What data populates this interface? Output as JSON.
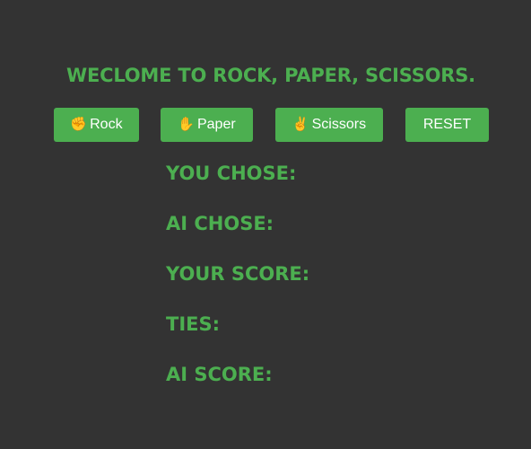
{
  "title": "WECLOME TO ROCK, PAPER, SCISSORS.",
  "buttons": {
    "rock": {
      "icon": "✊",
      "label": "Rock",
      "icon_name": "fist-icon"
    },
    "paper": {
      "icon": "✋",
      "label": "Paper",
      "icon_name": "hand-icon"
    },
    "scissors": {
      "icon": "✌",
      "label": "Scissors",
      "icon_name": "scissors-hand-icon"
    },
    "reset": {
      "label": "RESET"
    }
  },
  "stats": {
    "you_chose": "YOU CHOSE:",
    "ai_chose": "AI CHOSE:",
    "your_score": "YOUR SCORE:",
    "ties": "TIES:",
    "ai_score": "AI SCORE:"
  },
  "colors": {
    "background": "#333333",
    "accent": "#4caf50",
    "button_text": "#ffffff"
  }
}
